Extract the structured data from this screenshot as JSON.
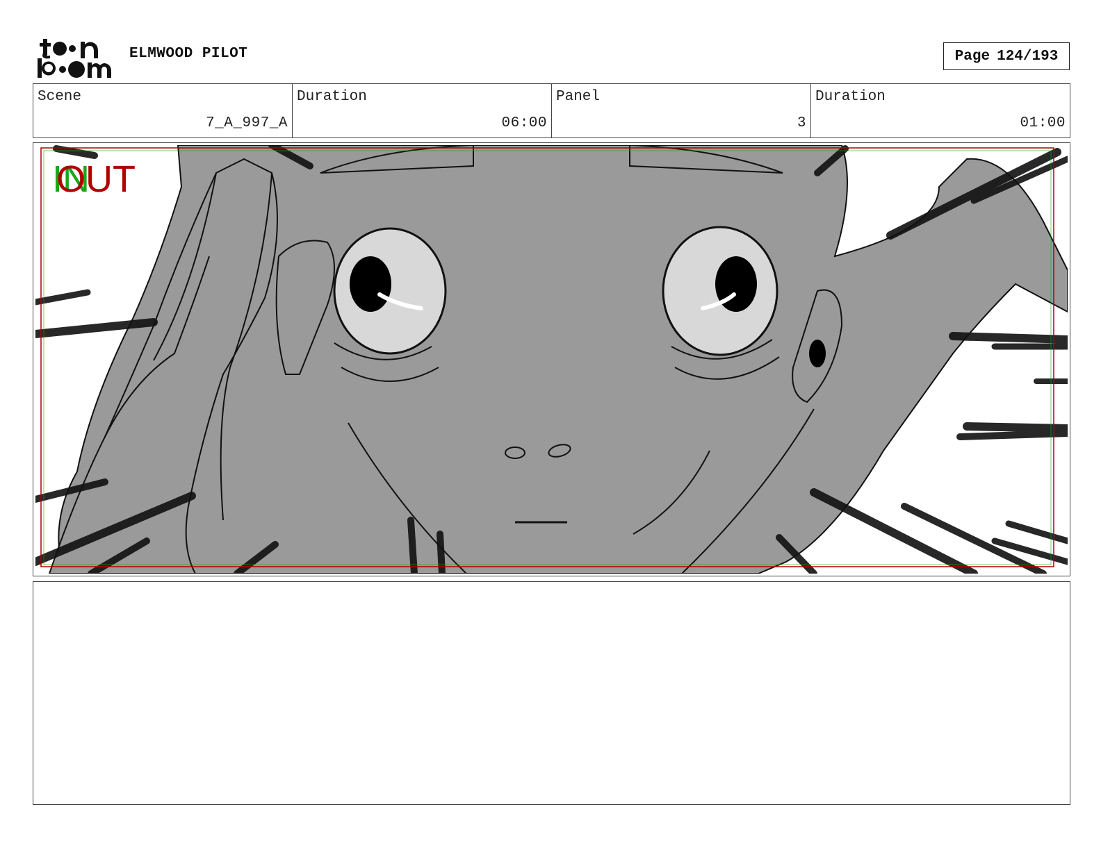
{
  "header": {
    "logo_text": "toon boom",
    "project_title": "ELMWOOD PILOT",
    "page_label": "Page",
    "page_number": "124/193"
  },
  "info": {
    "scene_label": "Scene",
    "scene_value": "7_A_997_A",
    "scene_duration_label": "Duration",
    "scene_duration_value": "06:00",
    "panel_label": "Panel",
    "panel_value": "3",
    "panel_duration_label": "Duration",
    "panel_duration_value": "01:00"
  },
  "panel": {
    "in_marker": "IN",
    "out_marker": "OUT",
    "in_color": "#1aa81a",
    "out_color": "#b00000",
    "face_fill": "#9a9a9a"
  },
  "notes": {
    "text": ""
  }
}
